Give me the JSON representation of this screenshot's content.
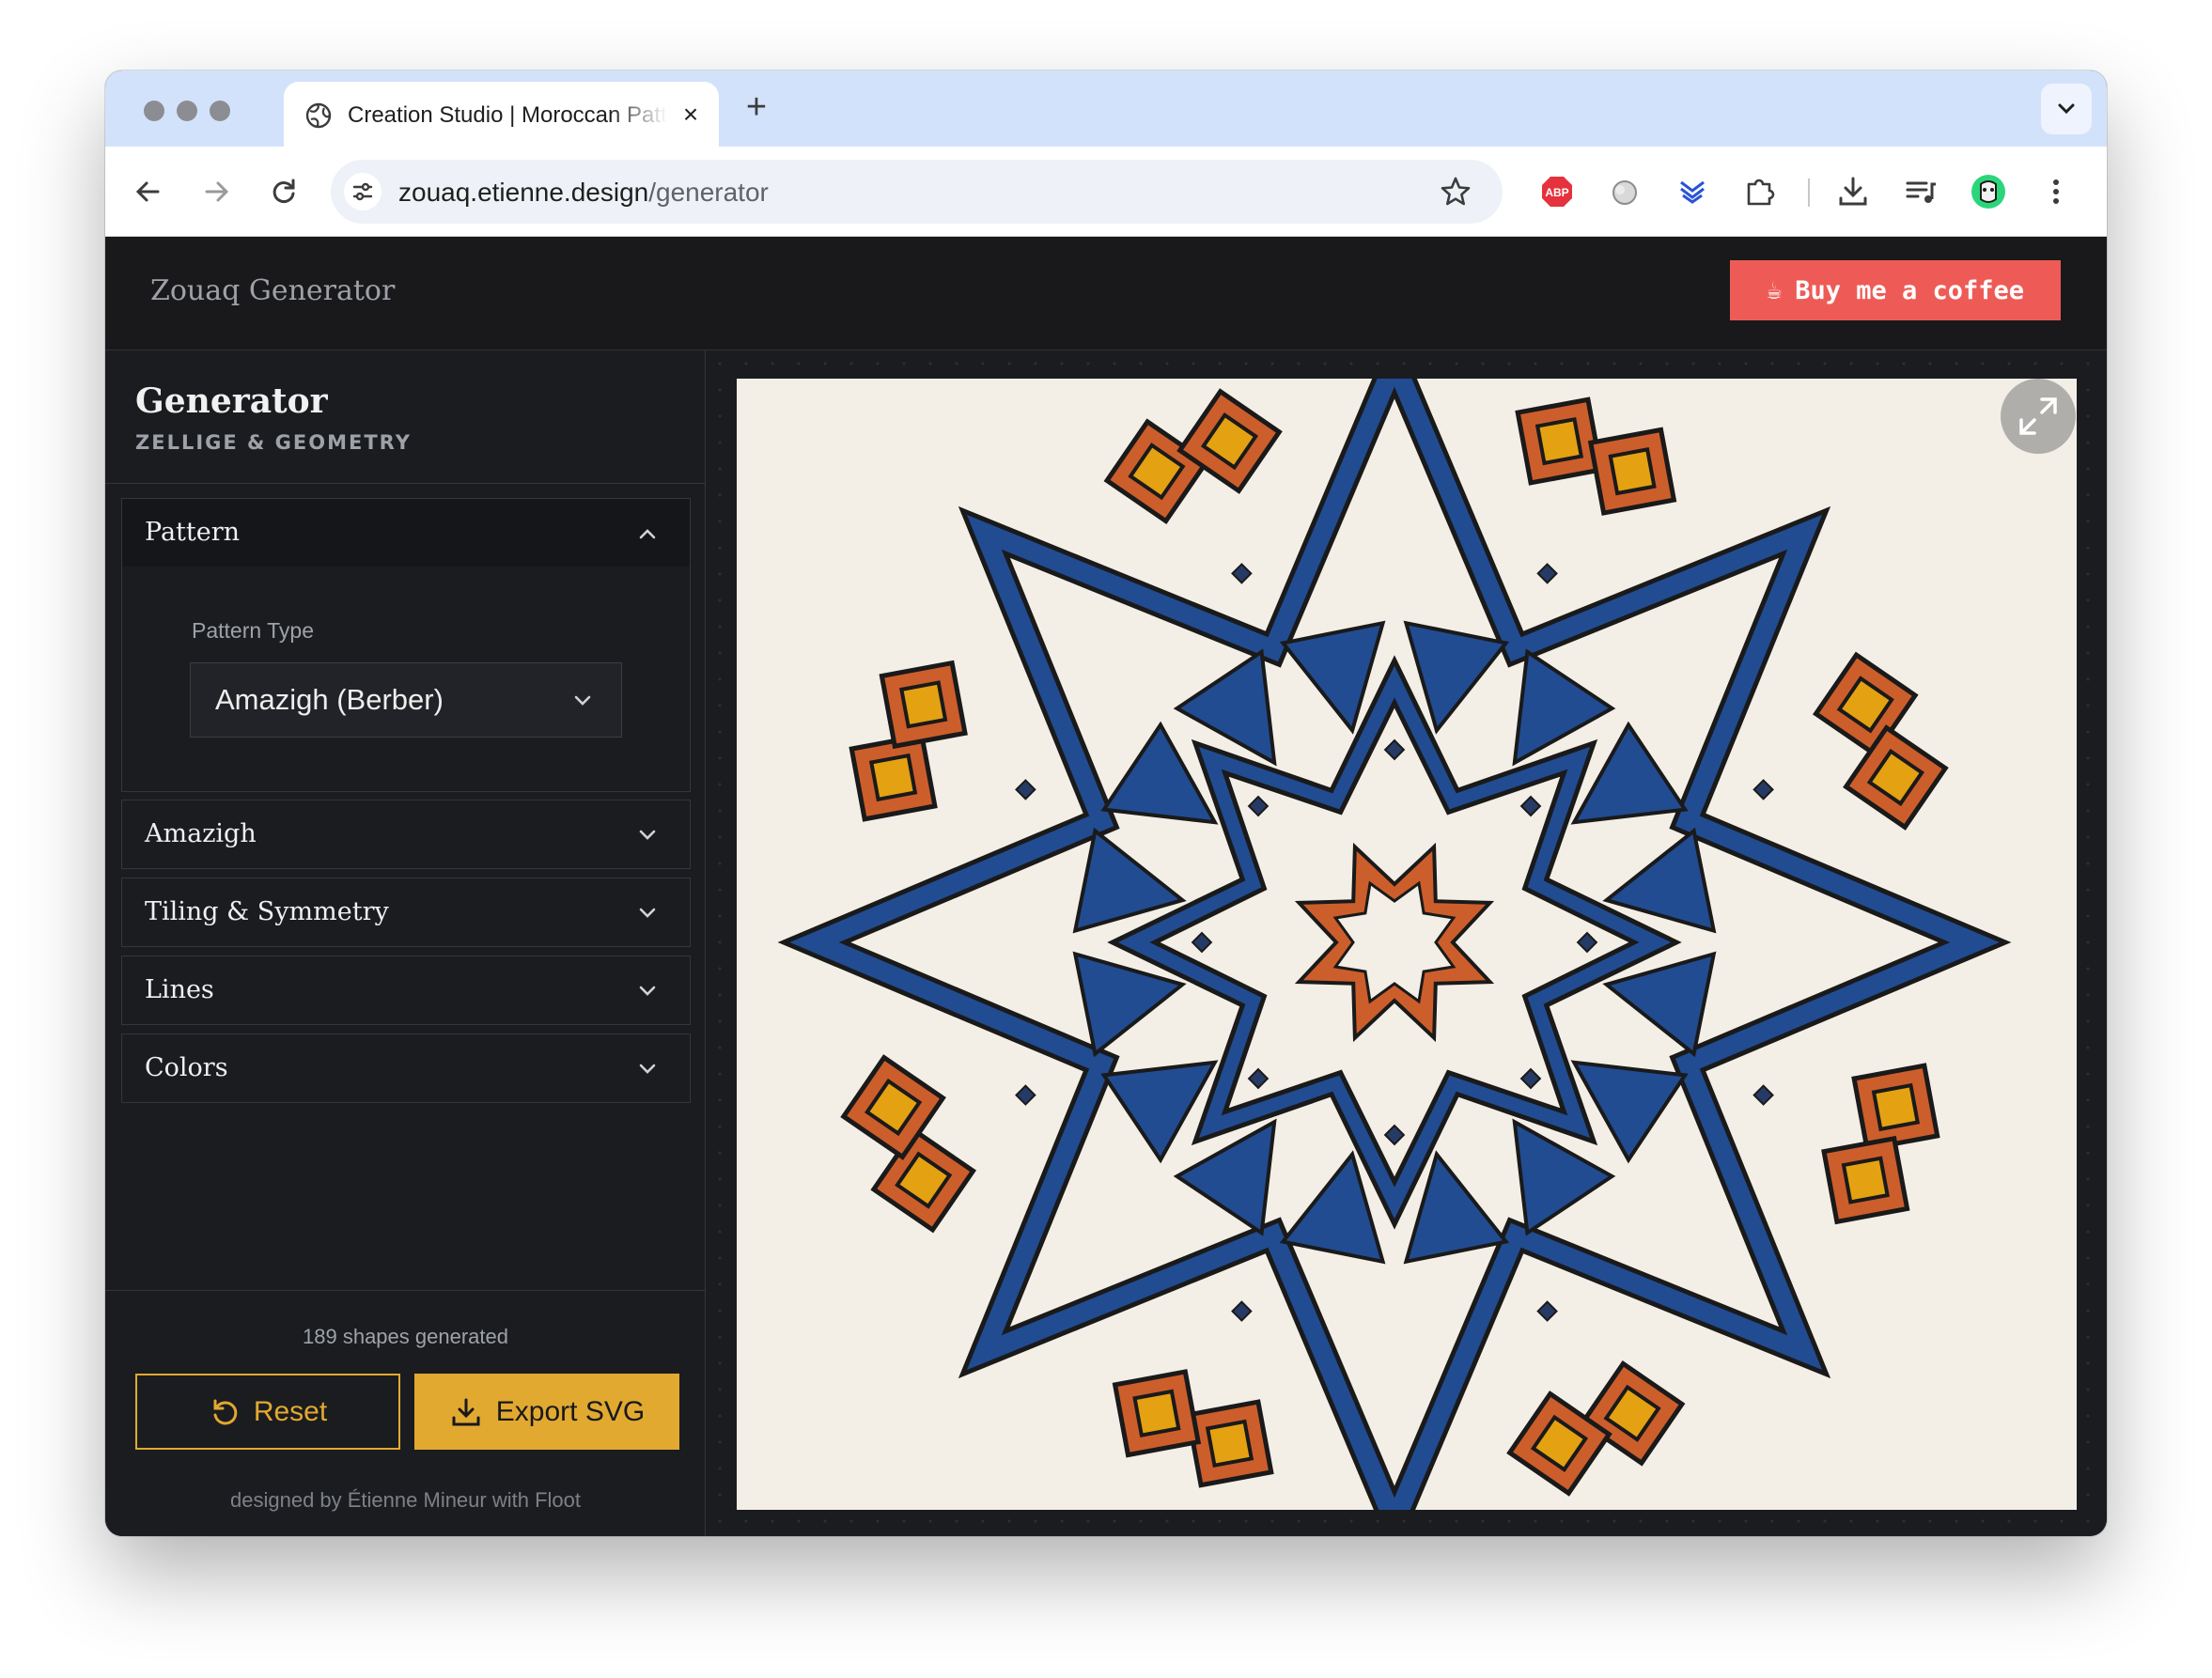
{
  "browser": {
    "tab_title": "Creation Studio | Moroccan Pattern Generator",
    "url_host": "zouaq.etienne.design",
    "url_path": "/generator",
    "new_tab": "+",
    "tab_close": "×",
    "extensions": [
      "adblock-plus-icon",
      "extension-puzzle-icon",
      "downloads-icon",
      "media-controls-icon",
      "profile-avatar-icon"
    ],
    "abp_label": "ABP"
  },
  "app": {
    "title": "Zouaq Generator",
    "coffee_label": "Buy me a coffee",
    "coffee_icon": "☕",
    "accent": "#e2a930",
    "coffee_color": "#ee5b56"
  },
  "sidebar": {
    "title": "Generator",
    "subtitle": "ZELLIGE & GEOMETRY",
    "sections": [
      {
        "label": "Pattern",
        "expanded": true
      },
      {
        "label": "Amazigh",
        "expanded": false
      },
      {
        "label": "Tiling & Symmetry",
        "expanded": false
      },
      {
        "label": "Lines",
        "expanded": false
      },
      {
        "label": "Colors",
        "expanded": false
      }
    ],
    "pattern_type_label": "Pattern Type",
    "pattern_type_value": "Amazigh (Berber)",
    "shapes_count": "189 shapes generated",
    "reset_label": "Reset",
    "export_label": "Export SVG",
    "credit": "designed by Étienne Mineur with Floot"
  },
  "artwork": {
    "background": "#f3efe6",
    "blue": "#214c92",
    "orange": "#cc5e2c",
    "gold": "#e4a112",
    "outline": "#1a1a1a",
    "star_points": 8
  }
}
